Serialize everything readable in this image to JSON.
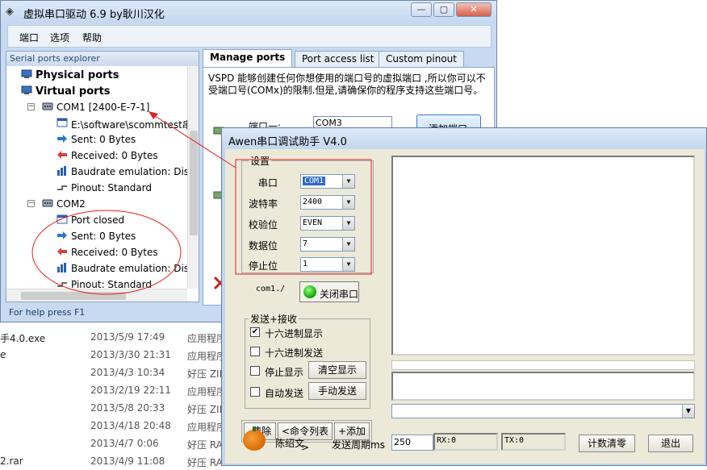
{
  "background_files": [
    {
      "name": "手4.0.exe",
      "date": "2013/5/9 17:49",
      "type": "应用程序"
    },
    {
      "name": "e",
      "date": "2013/3/30 21:31",
      "type": "应用程序"
    },
    {
      "name": "",
      "date": "2013/4/3 10:34",
      "type": "好压 ZIP"
    },
    {
      "name": "",
      "date": "2013/2/19 22:11",
      "type": "应用程序"
    },
    {
      "name": "",
      "date": "2013/5/8 20:33",
      "type": "好压 ZIP"
    },
    {
      "name": "",
      "date": "2013/4/18 20:48",
      "type": "应用程序"
    },
    {
      "name": "",
      "date": "2013/4/7 0:06",
      "type": "好压 RAR"
    },
    {
      "name": "2.rar",
      "date": "2013/4/9 11:08",
      "type": "好压 RAR"
    }
  ],
  "vspd": {
    "title": "虚拟串口驱动 6.9 by耿川汉化",
    "menu": [
      "端口",
      "选项",
      "帮助"
    ],
    "explorer_title": "Serial ports explorer",
    "tree": {
      "physical": "Physical ports",
      "virtual": "Virtual ports",
      "com1": "COM1 [2400-E-7-1]",
      "com1_children": [
        "E:\\software\\scommtest串",
        "Sent: 0 Bytes",
        "Received: 0 Bytes",
        "Baudrate emulation: Dis",
        "Pinout: Standard"
      ],
      "com2": "COM2",
      "com2_children": [
        "Port closed",
        "Sent: 0 Bytes",
        "Received: 0 Bytes",
        "Baudrate emulation: Dis",
        "Pinout: Standard"
      ]
    },
    "status": "For help press F1",
    "tabs": [
      "Manage ports",
      "Port access list",
      "Custom pinout"
    ],
    "description": "VSPD 能够创建任何你想使用的端口号的虚拟端口 ,所以你可以不受端口号(COMx)的限制.但是,请确保你的程序支持这些端口号。",
    "port1_label": "端口一:",
    "port1_value": "COM3",
    "add_button": "添加端口"
  },
  "awen": {
    "title": "Awen串口调试助手 V4.0",
    "settings_title": "设置",
    "settings": [
      {
        "label": "串口",
        "value": "COM1"
      },
      {
        "label": "波特率",
        "value": "2400"
      },
      {
        "label": "校验位",
        "value": "EVEN"
      },
      {
        "label": "数据位",
        "value": "7"
      },
      {
        "label": "停止位",
        "value": "1"
      }
    ],
    "com_status": "com1./",
    "close_port": "关闭串口",
    "sendrecv_title": "发送+接收",
    "hex_display": {
      "label": "十六进制显示",
      "checked": true
    },
    "hex_send": {
      "label": "十六进制发送",
      "checked": false
    },
    "stop_display": {
      "label": "停止显示",
      "checked": false
    },
    "auto_send": {
      "label": "自动发送",
      "checked": false
    },
    "clear_display": "清空显示",
    "manual_send": "手动发送",
    "clear_btn": "-清除",
    "cmd_list": "<命令列表>",
    "add_btn": "+添加",
    "author": "陈绍文",
    "period_label": "发送周期ms",
    "period_value": "250",
    "rx": "RX:0",
    "tx": "TX:0",
    "reset_count": "计数清零",
    "exit": "退出"
  },
  "annotation_color": "#e02020"
}
